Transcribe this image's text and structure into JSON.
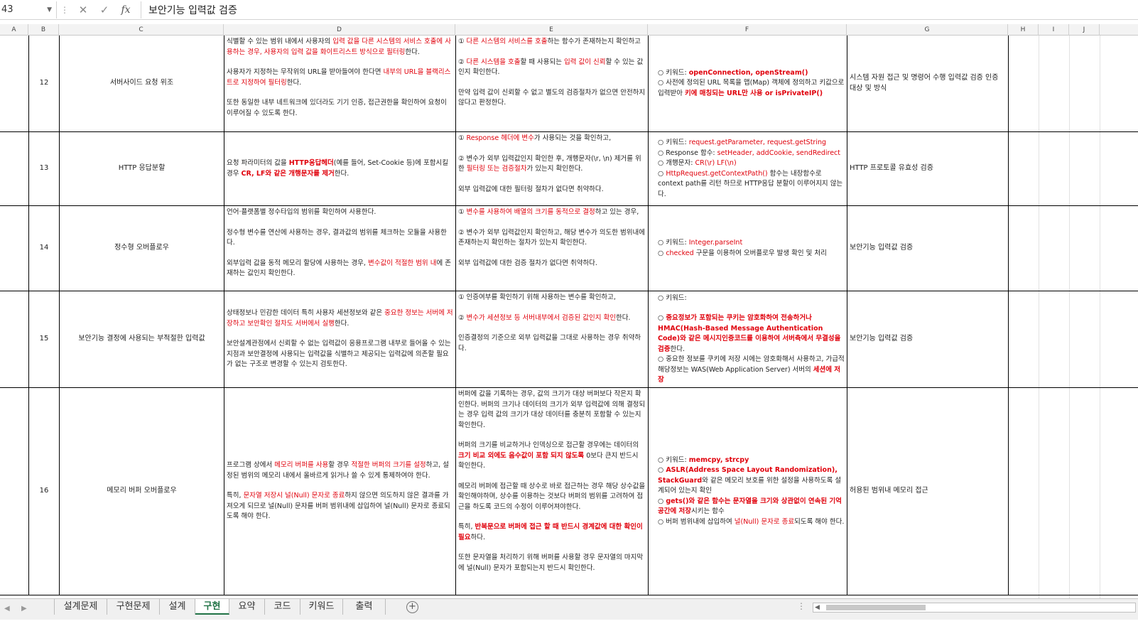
{
  "formula_bar": {
    "name_box": "43",
    "formula": "보안기능 입력값 검증"
  },
  "columns": [
    "A",
    "B",
    "C",
    "D",
    "E",
    "F",
    "G",
    "H",
    "I",
    "J"
  ],
  "rows": [
    {
      "number": "12",
      "category": "서버사이드 요청 위조",
      "d": [
        [
          {
            "t": "식별할 수 있는 범위 내에서 사용자의 "
          },
          {
            "t": "입력 값을 다른 시스템의 서비스 호출에 사용하는 경우, 사용자의 입력 값을 화이트리스트 방식으로 필터링",
            "c": "red"
          },
          {
            "t": "한다."
          }
        ],
        [
          {
            "t": "사용자가 지정하는 무작위의 URL을 받아들여야 한다면 "
          },
          {
            "t": "내부의 URL을 블랙리스트로 지정하여 필터링",
            "c": "red"
          },
          {
            "t": "한다."
          }
        ],
        [
          {
            "t": "또한 동일한 내부 네트워크에 있더라도 기기 인증, 접근권한을 확인하여 요청이 이루어질 수 있도록 한다."
          }
        ]
      ],
      "e": [
        [
          {
            "t": "① "
          },
          {
            "t": "다른 시스템의 서비스를 호출",
            "c": "red"
          },
          {
            "t": "하는 함수가 존재하는지 확인하고"
          }
        ],
        [
          {
            "t": "② "
          },
          {
            "t": "다른 시스템을 호출",
            "c": "red"
          },
          {
            "t": "할 때 사용되는 "
          },
          {
            "t": "입력 값이 신뢰",
            "c": "red"
          },
          {
            "t": "할 수 있는 값인지 확인한다."
          }
        ],
        [
          {
            "t": "만약 입력 값이 신뢰할 수 없고 별도의 검증절차가 없으면 안전하지 않다고 판정한다."
          }
        ]
      ],
      "f": [
        [
          {
            "t": "○ 키워드: "
          },
          {
            "t": "openConnection, openStream()",
            "c": "red",
            "b": true
          }
        ],
        [
          {
            "t": "○ 사전에 정의된 URL 목록을 맵(Map) 객체에 정의하고 키값으로 입력받아 "
          },
          {
            "t": "키에 매칭되는 URL만 사용 or isPrivateIP()",
            "c": "red",
            "b": true
          }
        ]
      ],
      "f_compact": true,
      "g": "시스템 자원 접근 및 명령어 수행 입력값 검증 인증 대상 및 방식"
    },
    {
      "number": "13",
      "category": "HTTP 응답분할",
      "d": [
        [
          {
            "t": "요청 파라미터의 값을 "
          },
          {
            "t": "HTTP응답헤더",
            "c": "red",
            "b": true
          },
          {
            "t": "(예를 들어, Set-Cookie 등)에 포함시킬 경우 "
          },
          {
            "t": "CR, LF와 같은 개행문자를 제거",
            "c": "red",
            "b": true
          },
          {
            "t": "한다."
          }
        ]
      ],
      "e": [
        [
          {
            "t": "① "
          },
          {
            "t": "Response 헤더에 변수",
            "c": "red"
          },
          {
            "t": "가 사용되는 것을 확인하고,"
          }
        ],
        [
          {
            "t": "② 변수가 외부 입력값인지 확인한 후, 개행문자(\\r, \\n) 제거를 위한 "
          },
          {
            "t": "필터링 또는 검증절차",
            "c": "red"
          },
          {
            "t": "가 있는지 확인한다."
          }
        ],
        [
          {
            "t": "외부 입력값에 대한 필터링 절차가 없다면 취약하다."
          }
        ]
      ],
      "f": [
        [
          {
            "t": "○ 키워드: "
          },
          {
            "t": "request.getParameter, request.getString",
            "c": "red"
          }
        ],
        [
          {
            "t": "○ Response 함수: "
          },
          {
            "t": "setHeader, addCookie, sendRedirect",
            "c": "red"
          }
        ],
        [
          {
            "t": "○ 개행문자: "
          },
          {
            "t": "CR(\\r) LF(\\n)",
            "c": "red"
          }
        ],
        [
          {
            "t": "○ "
          },
          {
            "t": "HttpRequest.getContextPath()",
            "c": "red"
          },
          {
            "t": " 함수는 내장함수로 context path를 리턴 하므로 HTTP응답 분할이 이루어지지 않는다."
          }
        ]
      ],
      "f_compact": true,
      "g": "HTTP 프로토콜 유효성 검증"
    },
    {
      "number": "14",
      "category": "정수형 오버플로우",
      "d": [
        [
          {
            "t": "언어·플랫폼별 정수타입의 범위를 확인하여 사용한다."
          }
        ],
        [
          {
            "t": "정수형 변수를 연산에 사용하는 경우, 결과값의 범위를 체크하는 모듈을 사용한다."
          }
        ],
        [
          {
            "t": "외부입력 값을 동적 메모리 할당에 사용하는 경우, "
          },
          {
            "t": "변수값이 적절한 범위 내",
            "c": "red"
          },
          {
            "t": "에 존재하는 값인지 확인한다."
          }
        ]
      ],
      "e": [
        [
          {
            "t": "① "
          },
          {
            "t": "변수를 사용하여 배열의 크기를 동적으로 결정",
            "c": "red"
          },
          {
            "t": "하고 있는 경우,"
          }
        ],
        [
          {
            "t": "② 변수가 외부 입력값인지 확인하고, 해당 변수가 의도한 범위내에 존재하는지 확인하는 절차가 있는지 확인한다."
          }
        ],
        [
          {
            "t": "외부 입력값에 대한 검증 절차가 없다면 취약하다."
          }
        ]
      ],
      "f": [
        [
          {
            "t": "○ 키워드: "
          },
          {
            "t": "Integer.parseInt",
            "c": "red"
          }
        ],
        [
          {
            "t": "○ "
          },
          {
            "t": "checked",
            "c": "red"
          },
          {
            "t": " 구문을 이용하여 오버플로우 발생 확인 및 처리"
          }
        ]
      ],
      "f_compact": true,
      "g": "보안기능 입력값 검증"
    },
    {
      "number": "15",
      "category": "보안기능 결정에 사용되는 부적절한 입력값",
      "d": [
        [
          {
            "t": "상태정보나 민감한 데이터 특히 사용자 세션정보와 같은 "
          },
          {
            "t": "중요한 정보는 서버에 저장하고 보안확인 절차도 서버에서 실행",
            "c": "red"
          },
          {
            "t": "한다."
          }
        ],
        [
          {
            "t": "보안설계관점에서 신뢰할 수 없는 입력값이 응용프로그램 내부로 들어올 수 있는 지점과 보안결정에 사용되는 입력값을 식별하고 제공되는 입력값에 의존할 필요가 없는 구조로 변경할 수 있는지 검토한다."
          }
        ]
      ],
      "e": [
        [
          {
            "t": "① 인증여부를 확인하기 위해 사용하는 변수를 확인하고,"
          }
        ],
        [
          {
            "t": "② "
          },
          {
            "t": "변수가 세션정보 등 서버내부에서 검증된 값인지 확인",
            "c": "red"
          },
          {
            "t": "한다."
          }
        ],
        [
          {
            "t": "인증결정의 기준으로 외부 입력값을 그대로 사용하는 경우 취약하다."
          }
        ]
      ],
      "f": [
        [
          {
            "t": "○ 키워드:"
          }
        ],
        [
          {
            "t": "○ "
          },
          {
            "t": "중요정보가 포함되는 쿠키는 암호화하여 전송하거나 HMAC(Hash-Based Message Authentication Code)와 같은 메시지인증코드를 이용하여 서버측에서 무결성을 검증",
            "c": "red",
            "b": true
          },
          {
            "t": "한다."
          },
          {
            "br": true
          },
          {
            "t": "○ 중요한 정보를 쿠키에 저장 시에는 암호화해서 사용하고, 가급적 해당정보는 WAS(Web Application Server) 서버의 "
          },
          {
            "t": "세션에 저장",
            "c": "red",
            "b": true
          }
        ]
      ],
      "f_compact": false,
      "g": "보안기능 입력값 검증"
    },
    {
      "number": "16",
      "category": "메모리 버퍼 오버플로우",
      "d": [
        [
          {
            "t": "프로그램 상에서 "
          },
          {
            "t": "메모리 버퍼를 사용",
            "c": "red"
          },
          {
            "t": "할 경우 "
          },
          {
            "t": "적절한 버퍼의 크기를 설정",
            "c": "red"
          },
          {
            "t": "하고, 설정된 범위의 메모리 내에서 올바르게 읽거나 쓸 수 있게 통제하여야 한다."
          }
        ],
        [
          {
            "t": "특히, "
          },
          {
            "t": "문자열 저장시 널(Null) 문자로 종료",
            "c": "red"
          },
          {
            "t": "하지 않으면 의도하지 않은 결과를 가져오게 되므로 널(Null) 문자를 버퍼 범위내에 삽입하여 널(Null) 문자로 종료되도록 해야 한다."
          }
        ]
      ],
      "e": [
        [
          {
            "t": "버퍼에 값을 기록하는 경우, 값의 크기가 대상 버퍼보다 작은지 확인한다. 버퍼의 크기나 데이터의 크기가 외부 입력값에 의해 결정되는 경우 입력 값의 크기가 대상 데이터를 충분히 포함할 수 있는지 확인한다."
          }
        ],
        [
          {
            "t": "버퍼의 크기를 비교하거나 인덱싱으로 접근할 경우에는 데이터의 "
          },
          {
            "t": "크기 비교 외에도 음수값이 포함 되지 않도록",
            "c": "red",
            "b": true
          },
          {
            "t": " 0보다 큰지 반드시 확인한다."
          }
        ],
        [
          {
            "t": "메모리 버퍼에 접근할 때 상수로 바로 접근하는 경우 해당 상수값을 확인해야하며, 상수를 이용하는 것보다 버퍼의 범위를 고려하여 접근을 하도록 코드의 수정이 이루어져야한다."
          }
        ],
        [
          {
            "t": "특히, "
          },
          {
            "t": "반복문으로 버퍼에 접근 할 때 반드시 경계값에 대한 확인이 필요",
            "c": "red",
            "b": true
          },
          {
            "t": "하다."
          }
        ],
        [
          {
            "t": "또한 문자열을 처리하기 위해 버퍼를 사용할 경우 문자열의 마지막에 널(Null) 문자가 포함되는지 반드시 확인한다."
          }
        ]
      ],
      "f": [
        [
          {
            "t": "○ 키워드: "
          },
          {
            "t": "memcpy, strcpy",
            "c": "red",
            "b": true
          }
        ],
        [
          {
            "t": "○ "
          },
          {
            "t": "ASLR(Address Space Layout Randomization), StackGuard",
            "c": "red",
            "b": true
          },
          {
            "t": "와 같은 메모리 보호를 위한 설정을 사용하도록 설계되어 있는지 확인"
          }
        ],
        [
          {
            "t": "○ "
          },
          {
            "t": "gets()와 같은 함수는 문자열을 크기와 상관없이 연속된 기억공간에 저장",
            "c": "red",
            "b": true
          },
          {
            "t": "시키는 함수"
          }
        ],
        [
          {
            "t": "○ 버퍼 범위내에 삽입하여 "
          },
          {
            "t": "널(Null) 문자로 종료",
            "c": "red"
          },
          {
            "t": "되도록 해야 한다."
          }
        ]
      ],
      "f_compact": true,
      "g": "허용된 범위내 메모리 접근"
    }
  ],
  "sheet_tabs": [
    "설계문제",
    "구현문제",
    "설계",
    "구현",
    "요약",
    "코드",
    "키워드",
    "출력"
  ],
  "active_tab": "구현",
  "colors": {
    "accent": "#217346",
    "highlight_text": "#e0000b",
    "border": "#000000"
  },
  "icons": {
    "cancel": "close-icon",
    "enter": "check-icon",
    "function": "fx-icon",
    "add_sheet": "plus-circle-icon"
  }
}
